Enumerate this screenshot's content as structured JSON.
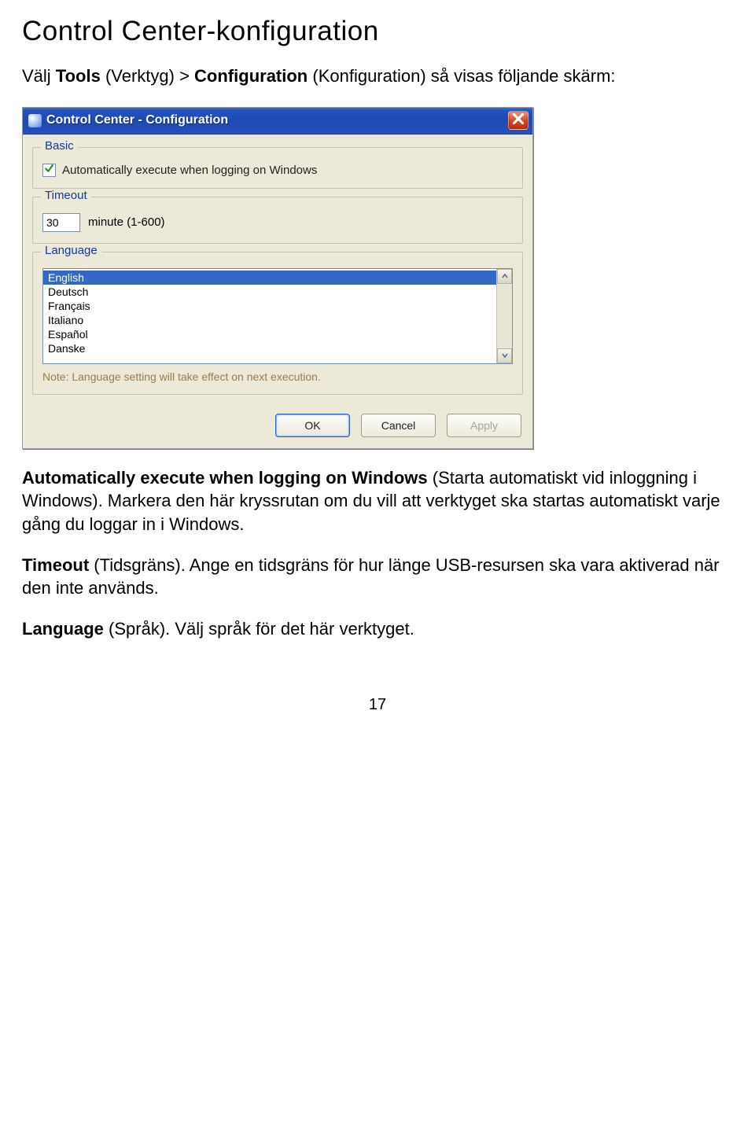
{
  "doc": {
    "heading": "Control Center-konfiguration",
    "intro_1": "Välj ",
    "intro_bold_1": "Tools",
    "intro_2": " (Verktyg) > ",
    "intro_bold_2": "Configuration",
    "intro_3": " (Konfiguration) så visas följande skärm:",
    "para1_bold": "Automatically execute when logging on Windows",
    "para1_rest": " (Starta automatiskt vid inloggning i Windows). Markera den här kryssrutan om du vill att verktyget ska startas automatiskt varje gång du loggar in i Windows.",
    "para2_bold": "Timeout",
    "para2_rest": " (Tidsgräns). Ange en tidsgräns för hur länge USB-resursen ska vara aktiverad när den inte används.",
    "para3_bold": "Language",
    "para3_rest": " (Språk). Välj språk för det här verktyget.",
    "page_number": "17"
  },
  "dialog": {
    "title": "Control Center - Configuration",
    "groups": {
      "basic": "Basic",
      "timeout": "Timeout",
      "language": "Language"
    },
    "checkbox_label": "Automatically execute when logging on Windows",
    "timeout_value": "30",
    "timeout_suffix": "minute (1-600)",
    "languages": [
      "English",
      "Deutsch",
      "Français",
      "Italiano",
      "Español",
      "Danske"
    ],
    "note": "Note: Language setting will take effect on next execution.",
    "buttons": {
      "ok": "OK",
      "cancel": "Cancel",
      "apply": "Apply"
    }
  }
}
